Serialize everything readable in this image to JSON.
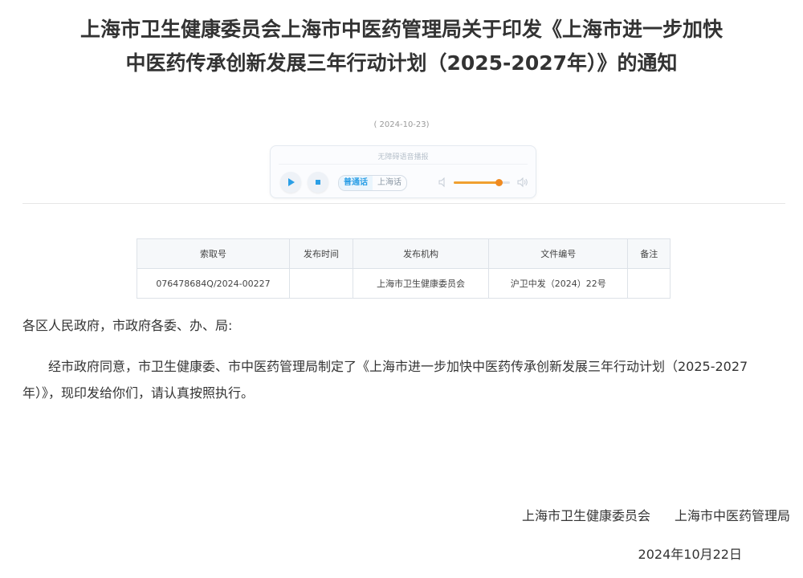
{
  "document": {
    "title": "上海市卫生健康委员会上海市中医药管理局关于印发《上海市进一步加快中医药传承创新发展三年行动计划（2025-2027年）》的通知",
    "date": "( 2024-10-23)"
  },
  "player": {
    "caption": "无障碍语音播报",
    "languages": [
      "普通话",
      "上海话"
    ],
    "active_language": "普通话",
    "volume": 0.8,
    "icons": {
      "play": "play-icon",
      "stop": "stop-icon",
      "volume_low": "volume-low-icon",
      "volume_high": "volume-high-icon"
    },
    "colors": {
      "accent": "#2b9fe6",
      "slider": "#f0a030"
    }
  },
  "meta_table": {
    "headers": [
      "索取号",
      "发布时间",
      "发布机构",
      "文件编号",
      "备注"
    ],
    "rows": [
      [
        "076478684Q/2024-00227",
        "",
        "上海市卫生健康委员会",
        "沪卫中发（2024）22号",
        ""
      ]
    ]
  },
  "body": {
    "salutation": "各区人民政府，市政府各委、办、局:",
    "paragraph": "经市政府同意，市卫生健康委、市中医药管理局制定了《上海市进一步加快中医药传承创新发展三年行动计划（2025-2027年）》，现印发给你们，请认真按照执行。"
  },
  "signature": {
    "org1": "上海市卫生健康委员会",
    "org2": "上海市中医药管理局",
    "date": "2024年10月22日"
  }
}
